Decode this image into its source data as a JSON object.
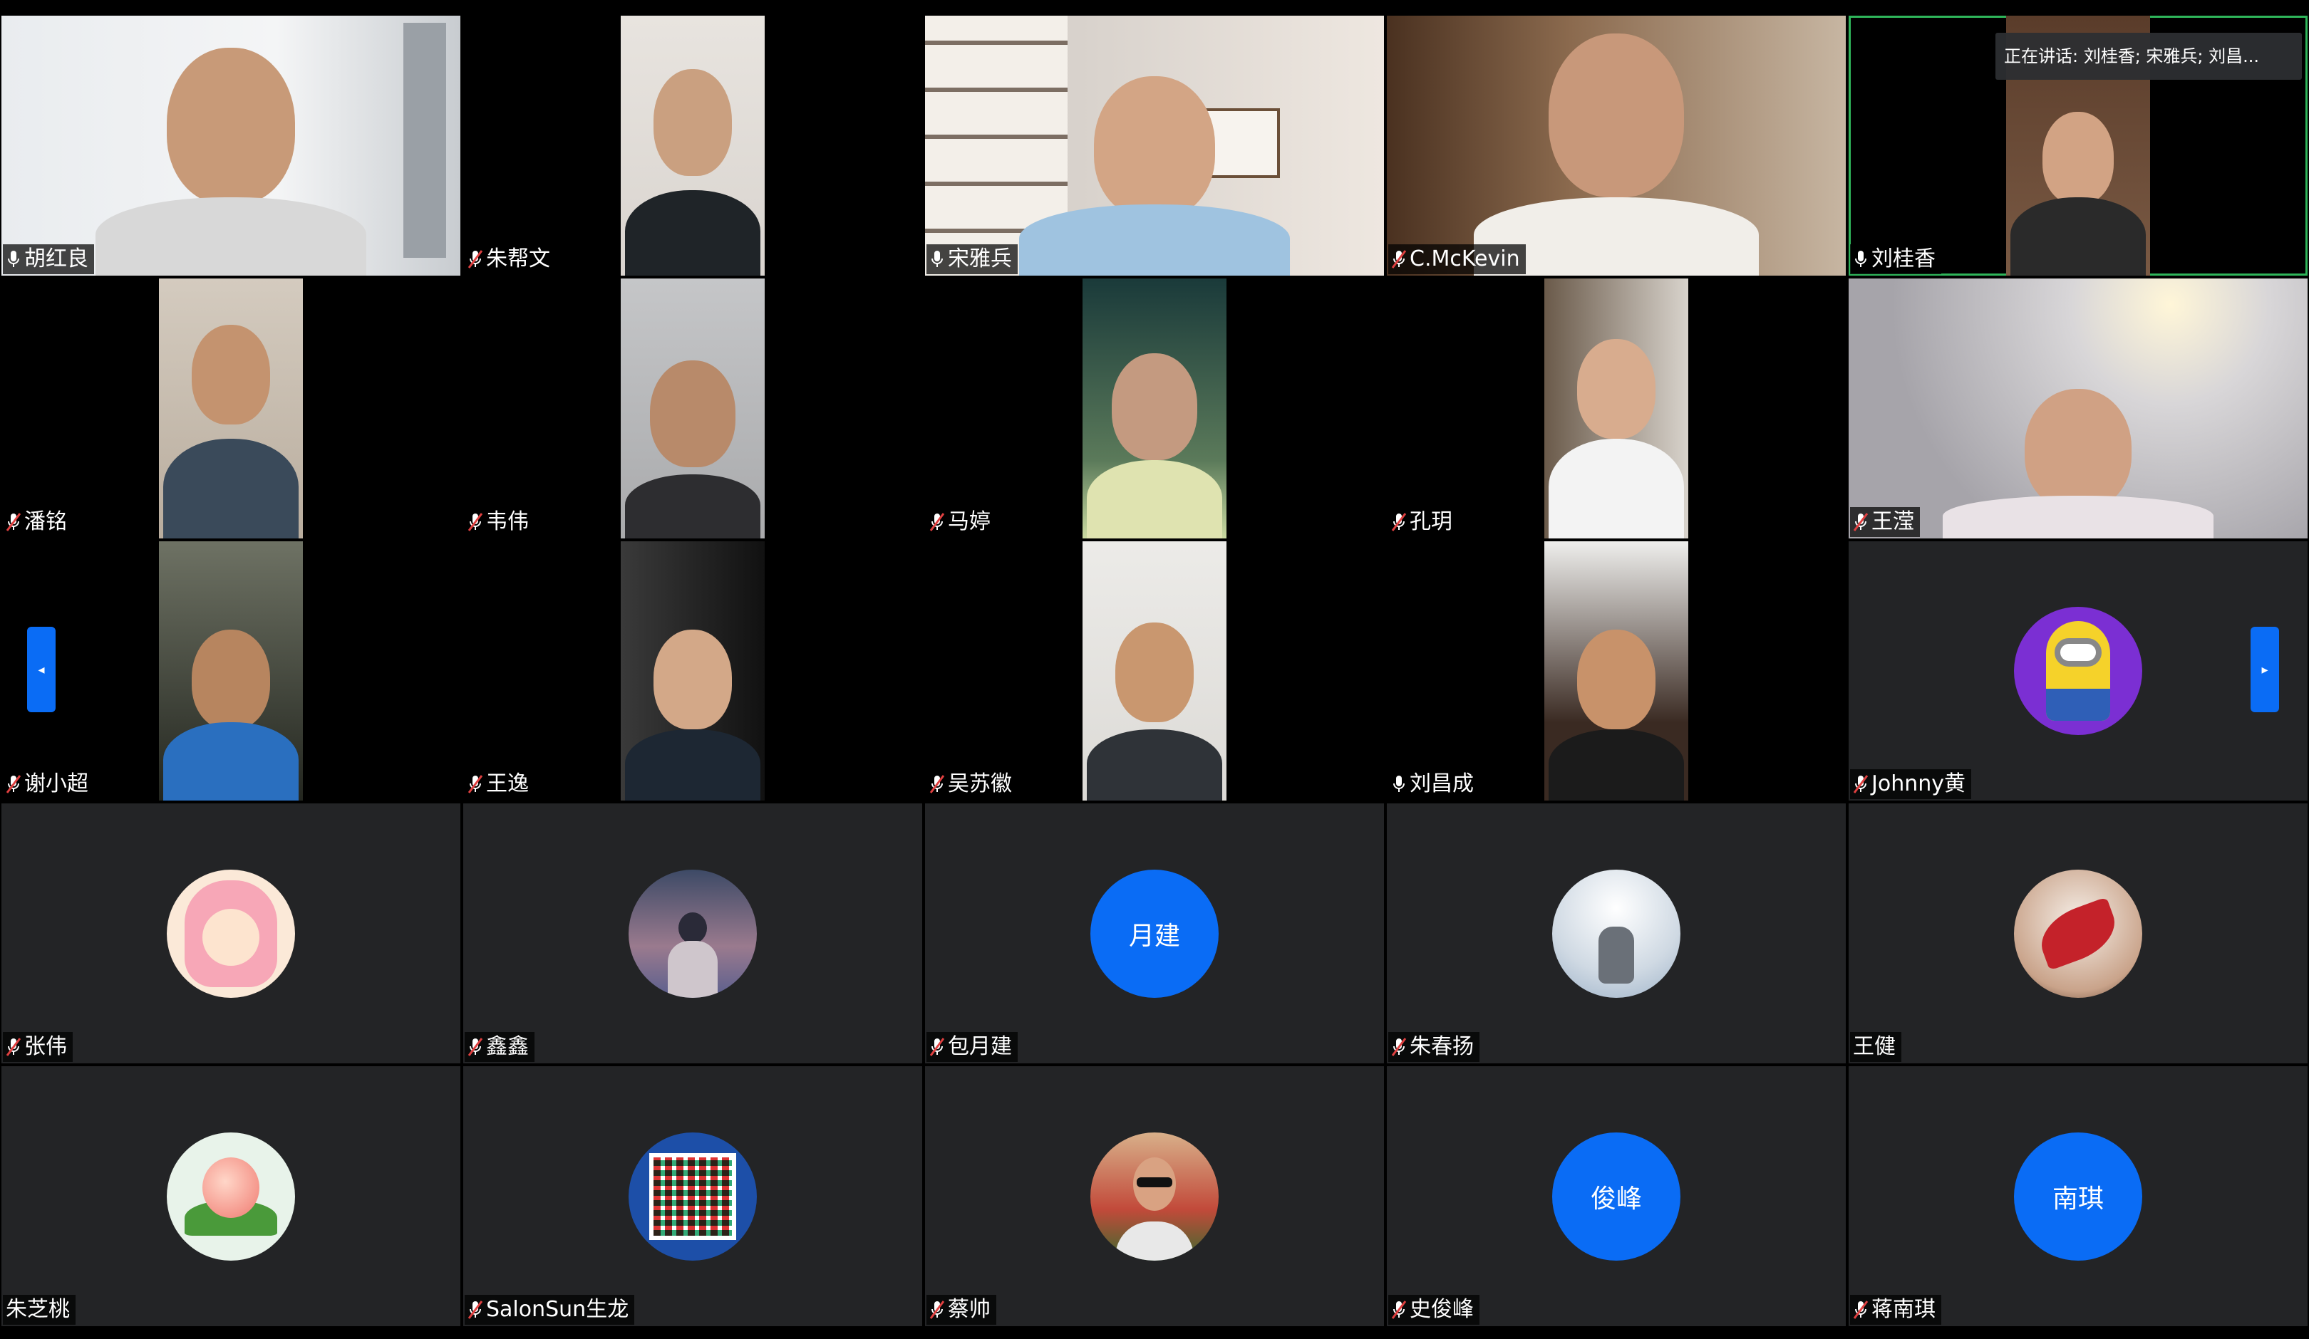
{
  "speaking_banner": "正在讲话: 刘桂香; 宋雅兵; 刘昌...",
  "nav": {
    "left_icon": "chevron-left",
    "right_icon": "chevron-right",
    "left_glyph": "◂",
    "right_glyph": "▸"
  },
  "colors": {
    "accent": "#0a6cf5",
    "active_speaker": "#2fb55a",
    "tile_bg": "#232426",
    "mic_muted": "#e04040"
  },
  "participants": [
    {
      "name": "胡红良",
      "mic": "on"
    },
    {
      "name": "朱帮文",
      "mic": "muted"
    },
    {
      "name": "宋雅兵",
      "mic": "on"
    },
    {
      "name": "C.McKevin",
      "mic": "muted"
    },
    {
      "name": "刘桂香",
      "mic": "on"
    },
    {
      "name": "潘铭",
      "mic": "muted"
    },
    {
      "name": "韦伟",
      "mic": "muted"
    },
    {
      "name": "马婷",
      "mic": "muted"
    },
    {
      "name": "孔玥",
      "mic": "muted"
    },
    {
      "name": "王滢",
      "mic": "muted"
    },
    {
      "name": "谢小超",
      "mic": "muted"
    },
    {
      "name": "王逸",
      "mic": "muted"
    },
    {
      "name": "吴苏徽",
      "mic": "muted"
    },
    {
      "name": "刘昌成",
      "mic": "on"
    },
    {
      "name": "Johnny黄",
      "mic": "muted"
    },
    {
      "name": "张伟",
      "mic": "muted"
    },
    {
      "name": "鑫鑫",
      "mic": "muted"
    },
    {
      "name": "包月建",
      "mic": "muted",
      "avatar_text": "月建"
    },
    {
      "name": "朱春扬",
      "mic": "muted"
    },
    {
      "name": "王健",
      "mic": "none"
    },
    {
      "name": "朱芝桃",
      "mic": "none"
    },
    {
      "name": "SalonSun生龙",
      "mic": "muted"
    },
    {
      "name": "蔡帅",
      "mic": "muted"
    },
    {
      "name": "史俊峰",
      "mic": "muted",
      "avatar_text": "俊峰"
    },
    {
      "name": "蒋南琪",
      "mic": "muted",
      "avatar_text": "南琪"
    }
  ]
}
